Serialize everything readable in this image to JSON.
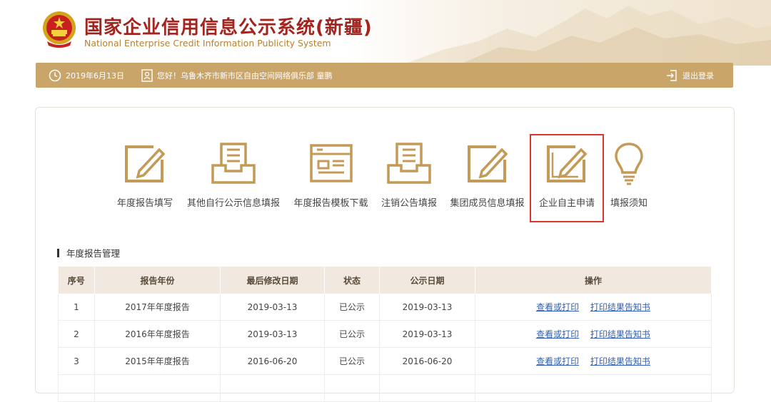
{
  "header": {
    "title_zh": "国家企业信用信息公示系统(新疆)",
    "title_en": "National Enterprise Credit Information Publicity System"
  },
  "topbar": {
    "date": "2019年6月13日",
    "greeting": "您好！乌鲁木齐市新市区自由空间网络俱乐部  童鹏",
    "logout": "退出登录"
  },
  "functions": [
    {
      "label": "年度报告填写",
      "icon": "edit-form-icon"
    },
    {
      "label": "其他自行公示信息填报",
      "icon": "document-tray-icon"
    },
    {
      "label": "年度报告模板下载",
      "icon": "template-icon"
    },
    {
      "label": "注销公告填报",
      "icon": "document-tray-icon"
    },
    {
      "label": "集团成员信息填报",
      "icon": "edit-form-icon"
    },
    {
      "label": "企业自主申请",
      "icon": "edit-form-icon"
    },
    {
      "label": "填报须知",
      "icon": "lightbulb-icon"
    }
  ],
  "section": {
    "title": "年度报告管理"
  },
  "table": {
    "headers": [
      "序号",
      "报告年份",
      "最后修改日期",
      "状态",
      "公示日期",
      "操作"
    ],
    "rows": [
      {
        "no": "1",
        "year": "2017年年度报告",
        "modified": "2019-03-13",
        "status": "已公示",
        "published": "2019-03-13",
        "op1": "查看或打印",
        "op2": "打印结果告知书"
      },
      {
        "no": "2",
        "year": "2016年年度报告",
        "modified": "2019-03-13",
        "status": "已公示",
        "published": "2019-03-13",
        "op1": "查看或打印",
        "op2": "打印结果告知书"
      },
      {
        "no": "3",
        "year": "2015年年度报告",
        "modified": "2016-06-20",
        "status": "已公示",
        "published": "2016-06-20",
        "op1": "查看或打印",
        "op2": "打印结果告知书"
      }
    ]
  },
  "colors": {
    "gold": "#c9a56a",
    "title_red": "#a3231f",
    "highlight": "#d9362a",
    "link": "#2f5fb3"
  }
}
